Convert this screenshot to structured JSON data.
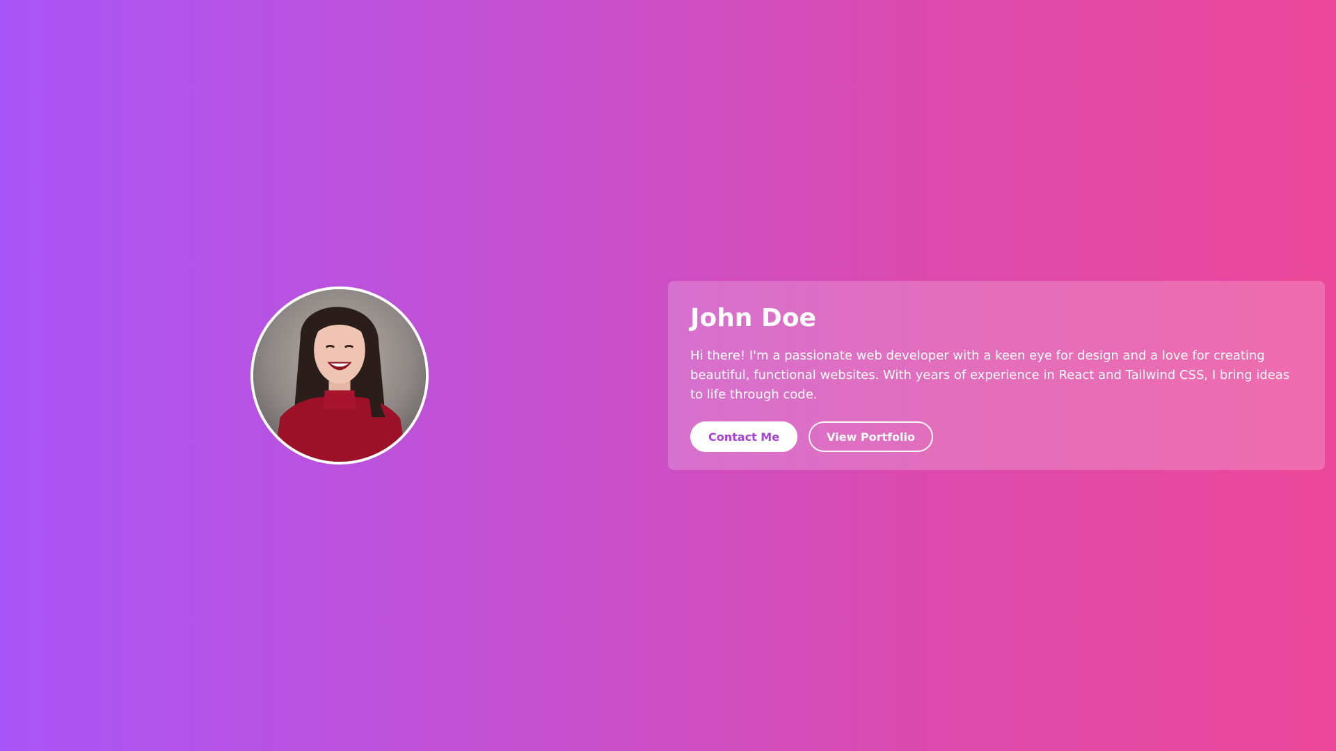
{
  "profile": {
    "name": "John Doe",
    "bio": "Hi there! I'm a passionate web developer with a keen eye for design and a love for creating beautiful, functional websites. With years of experience in React and Tailwind CSS, I bring ideas to life through code.",
    "avatar_icon": "profile-photo"
  },
  "actions": {
    "contact_label": "Contact Me",
    "portfolio_label": "View Portfolio"
  },
  "colors": {
    "gradient_start": "#a855f7",
    "gradient_end": "#ec4899",
    "button_text_accent": "#a63fd4"
  }
}
